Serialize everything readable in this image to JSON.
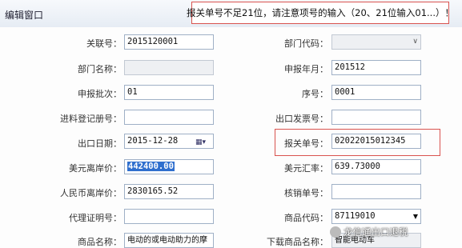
{
  "window": {
    "title": "编辑窗口"
  },
  "warning": "报关单号不足21位，请注意项号的输入（20、21位输入01...）！",
  "fields": {
    "link_no": {
      "label": "关联号：",
      "value": "2015120001"
    },
    "dept_code": {
      "label": "部门代码：",
      "value": ""
    },
    "dept_name": {
      "label": "部门名称：",
      "value": ""
    },
    "declare_month": {
      "label": "申报年月：",
      "value": "201512"
    },
    "declare_batch": {
      "label": "申报批次：",
      "value": "01"
    },
    "seq_no": {
      "label": "序号：",
      "value": "0001"
    },
    "import_reg_no": {
      "label": "进料登记册号：",
      "value": ""
    },
    "export_invoice": {
      "label": "出口发票号：",
      "value": ""
    },
    "export_date": {
      "label": "出口日期：",
      "value": "2015-12-28"
    },
    "customs_no": {
      "label": "报关单号：",
      "value": "02022015012345"
    },
    "usd_fob": {
      "label": "美元离岸价：",
      "value": "442400.00"
    },
    "usd_rate": {
      "label": "美元汇率：",
      "value": "639.73000"
    },
    "rmb_fob": {
      "label": "人民币离岸价：",
      "value": "2830165.52"
    },
    "verify_no": {
      "label": "核销单号：",
      "value": ""
    },
    "agent_cert": {
      "label": "代理证明号：",
      "value": ""
    },
    "goods_code": {
      "label": "商品代码：",
      "value": "87119010"
    },
    "goods_name": {
      "label": "商品名称：",
      "value": "电动的或电动助力的摩"
    },
    "dl_goods_name": {
      "label": "下载商品名称：",
      "value": "智能电动车"
    }
  },
  "watermark": "龙信通出口退税",
  "icons": {
    "calendar": "calendar-icon",
    "dropdown": "chevron-down-icon"
  }
}
